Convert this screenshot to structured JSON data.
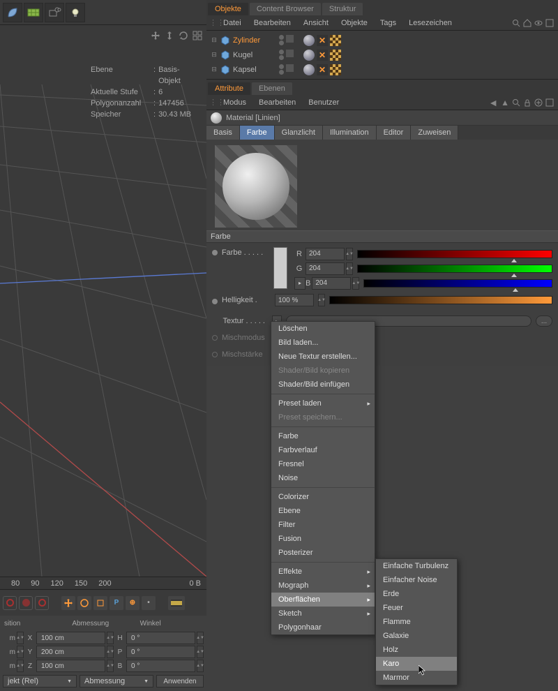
{
  "topToolbarIcons": [
    "leaf",
    "grid",
    "camera",
    "light"
  ],
  "viewport": {
    "hud": {
      "ebene": "Ebene",
      "ebene_v": "Basis-Objekt",
      "stufe": "Aktuelle Stufe",
      "stufe_v": "6",
      "poly": "Polygonanzahl",
      "poly_v": "147456",
      "mem": "Speicher",
      "mem_v": "30.43 MB",
      "sep": ":"
    },
    "ruler": [
      "80",
      "90",
      "120",
      "150",
      "200"
    ],
    "ruler_right": "0 B"
  },
  "coord": {
    "headers": [
      "sition",
      "Abmessung",
      "Winkel"
    ],
    "rows": [
      {
        "u": "m",
        "a": "X",
        "v": "100 cm",
        "a2": "H",
        "v2": "0 °"
      },
      {
        "u": "m",
        "a": "Y",
        "v": "200 cm",
        "a2": "P",
        "v2": "0 °"
      },
      {
        "u": "m",
        "a": "Z",
        "v": "100 cm",
        "a2": "B",
        "v2": "0 °"
      }
    ],
    "dd1": "jekt (Rel)",
    "dd2": "Abmessung",
    "btn": "Anwenden"
  },
  "om": {
    "tabs": [
      "Objekte",
      "Content Browser",
      "Struktur"
    ],
    "menu": [
      "Datei",
      "Bearbeiten",
      "Ansicht",
      "Objekte",
      "Tags",
      "Lesezeichen"
    ],
    "objects": [
      {
        "name": "Zylinder",
        "sel": true
      },
      {
        "name": "Kugel",
        "sel": false
      },
      {
        "name": "Kapsel",
        "sel": false
      }
    ]
  },
  "am": {
    "tabs": [
      "Attribute",
      "Ebenen"
    ],
    "menu": [
      "Modus",
      "Bearbeiten",
      "Benutzer"
    ],
    "title": "Material [Linien]",
    "channels": [
      "Basis",
      "Farbe",
      "Glanzlicht",
      "Illumination",
      "Editor",
      "Zuweisen"
    ],
    "section": "Farbe",
    "color": {
      "label": "Farbe . . . . .",
      "r": "R",
      "g": "G",
      "b": "B",
      "rv": "204",
      "gv": "204",
      "bv": "204"
    },
    "brightness": {
      "label": "Helligkeit .",
      "value": "100 %"
    },
    "texture": {
      "label": "Textur . . . . .",
      "browse": "..."
    },
    "mixmode": "Mischmodus",
    "mixstr": "Mischstärke"
  },
  "popup1": [
    {
      "t": "Löschen"
    },
    {
      "t": "Bild laden..."
    },
    {
      "t": "Neue Textur erstellen..."
    },
    {
      "t": "Shader/Bild kopieren",
      "d": true
    },
    {
      "t": "Shader/Bild einfügen"
    },
    {
      "sep": true
    },
    {
      "t": "Preset laden",
      "sub": true
    },
    {
      "t": "Preset speichern...",
      "d": true
    },
    {
      "sep": true
    },
    {
      "t": "Farbe"
    },
    {
      "t": "Farbverlauf"
    },
    {
      "t": "Fresnel"
    },
    {
      "t": "Noise"
    },
    {
      "sep": true
    },
    {
      "t": "Colorizer"
    },
    {
      "t": "Ebene"
    },
    {
      "t": "Filter"
    },
    {
      "t": "Fusion"
    },
    {
      "t": "Posterizer"
    },
    {
      "sep": true
    },
    {
      "t": "Effekte",
      "sub": true
    },
    {
      "t": "Mograph",
      "sub": true
    },
    {
      "t": "Oberflächen",
      "sub": true,
      "hover": true
    },
    {
      "t": "Sketch",
      "sub": true
    },
    {
      "t": "Polygonhaar"
    }
  ],
  "popup2": [
    {
      "t": "Einfache Turbulenz"
    },
    {
      "t": "Einfacher Noise"
    },
    {
      "t": "Erde"
    },
    {
      "t": "Feuer"
    },
    {
      "t": "Flamme"
    },
    {
      "t": "Galaxie"
    },
    {
      "t": "Holz"
    },
    {
      "t": "Karo",
      "hover": true
    },
    {
      "t": "Marmor"
    }
  ]
}
